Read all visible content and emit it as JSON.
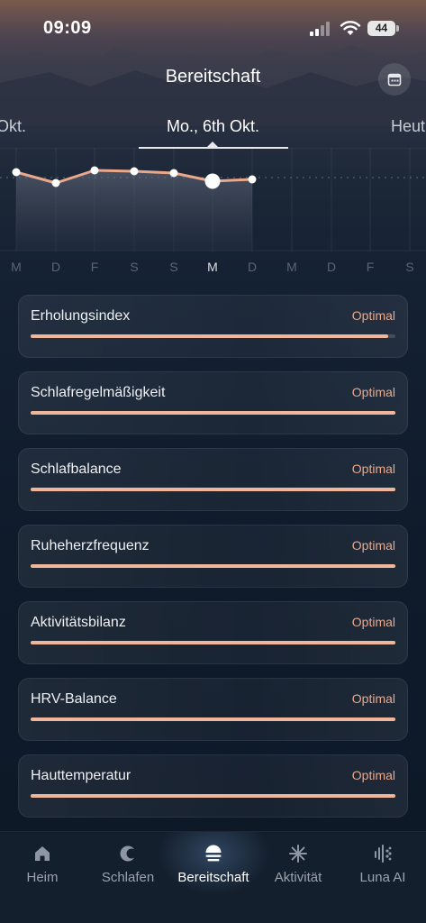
{
  "status_bar": {
    "time": "09:09",
    "battery": "44"
  },
  "header": {
    "title": "Bereitschaft",
    "calendar_icon": "calendar-icon"
  },
  "date_nav": {
    "prev": "Okt.",
    "current": "Mo., 6th Okt.",
    "next": "Heut"
  },
  "weekdays": [
    "M",
    "D",
    "F",
    "S",
    "S",
    "M",
    "D",
    "M",
    "D",
    "F",
    "S"
  ],
  "selected_weekday_index": 5,
  "metrics": [
    {
      "name": "Erholungsindex",
      "status": "Optimal",
      "level": 0.98
    },
    {
      "name": "Schlafregelmäßigkeit",
      "status": "Optimal",
      "level": 1.0
    },
    {
      "name": "Schlafbalance",
      "status": "Optimal",
      "level": 1.0
    },
    {
      "name": "Ruheherzfrequenz",
      "status": "Optimal",
      "level": 1.0
    },
    {
      "name": "Aktivitätsbilanz",
      "status": "Optimal",
      "level": 1.0
    },
    {
      "name": "HRV-Balance",
      "status": "Optimal",
      "level": 1.0
    },
    {
      "name": "Hauttemperatur",
      "status": "Optimal",
      "level": 1.0
    }
  ],
  "bottom_nav": [
    {
      "label": "Heim",
      "icon": "home-icon"
    },
    {
      "label": "Schlafen",
      "icon": "moon-icon"
    },
    {
      "label": "Bereitschaft",
      "icon": "sunrise-icon",
      "active": true
    },
    {
      "label": "Aktivität",
      "icon": "activity-icon"
    },
    {
      "label": "Luna AI",
      "icon": "sparkle-icon"
    }
  ],
  "colors": {
    "accent": "#f0b69b",
    "status": "#e7a98e",
    "background": "#0d1827"
  }
}
